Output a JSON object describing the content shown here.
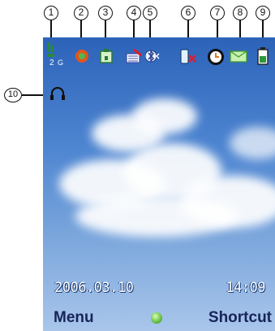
{
  "callouts": {
    "c1": "1",
    "c2": "2",
    "c3": "3",
    "c4": "4",
    "c5": "5",
    "c6": "6",
    "c7": "7",
    "c8": "8",
    "c9": "9",
    "c10": "10"
  },
  "status_icons": [
    "signal-strength-icon",
    "roaming-icon",
    "java-app-icon",
    "missed-call-icon",
    "bluetooth-icon",
    "silent-mode-icon",
    "alarm-clock-icon",
    "message-icon",
    "battery-icon"
  ],
  "screen": {
    "date": "2006.03.10",
    "time": "14:09",
    "softkey_left": "Menu",
    "softkey_right": "Shortcut",
    "network_label": "G"
  },
  "colors": {
    "sky_top": "#2c63b9",
    "sky_bottom": "#a9c6ea",
    "softkey_text": "#18245a",
    "center_key": "#6cc14a"
  }
}
